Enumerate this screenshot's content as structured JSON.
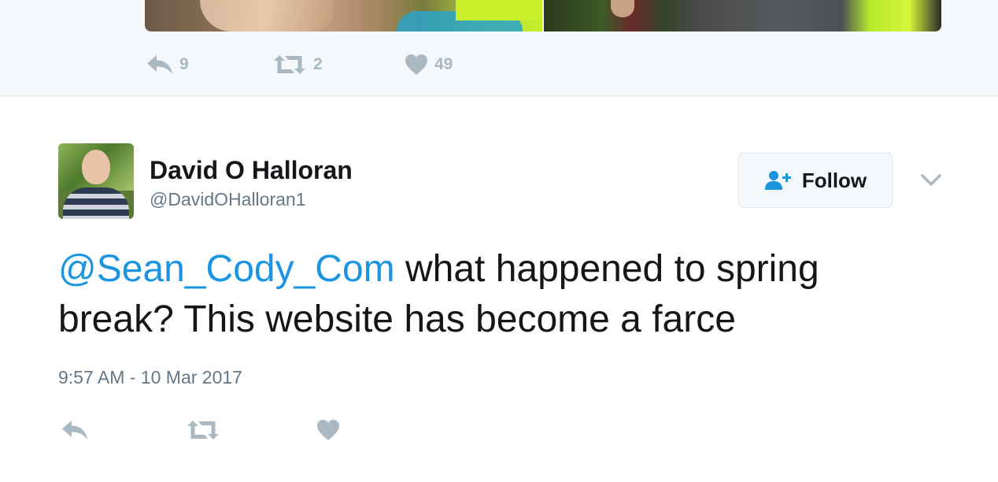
{
  "previous_tweet": {
    "actions": {
      "reply_count": "9",
      "retweet_count": "2",
      "like_count": "49"
    },
    "media": [
      "photo-left",
      "photo-right"
    ]
  },
  "tweet": {
    "author": {
      "fullname": "David O Halloran",
      "username": "@DavidOHalloran1"
    },
    "follow_label": "Follow",
    "text": {
      "mention": "@Sean_Cody_Com",
      "body": " what happened to spring break? This website has become a farce"
    },
    "timestamp": "9:57 AM - 10 Mar 2017"
  },
  "icons": {
    "reply": "reply-icon",
    "retweet": "retweet-icon",
    "like": "heart-icon",
    "follow": "add-user-icon",
    "menu": "chevron-down-icon"
  },
  "colors": {
    "icon_gray": "#aab8c2",
    "link_blue": "#1b95e0",
    "text": "#14171a",
    "secondary_text": "#657786",
    "stream_bg": "#f5f8fa"
  }
}
